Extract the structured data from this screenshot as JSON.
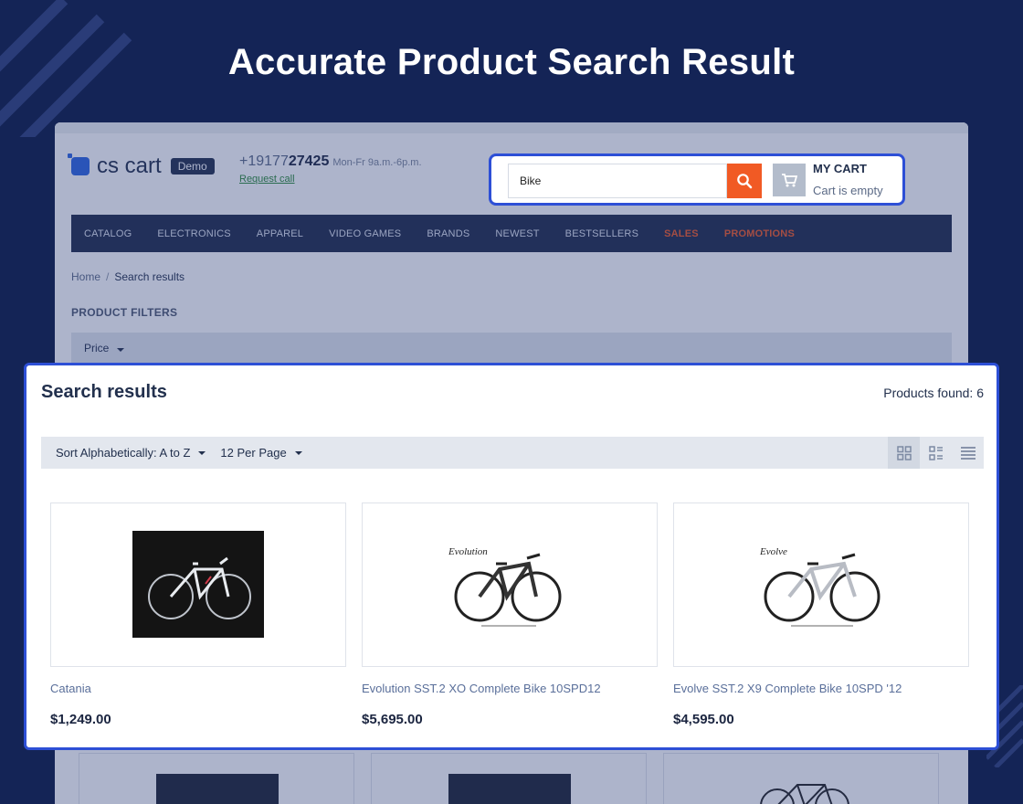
{
  "page": {
    "title": "Accurate Product Search Result"
  },
  "store": {
    "logo_text": "cs cart",
    "logo_badge": "Demo",
    "phone_prefix": "+19177",
    "phone_main": "27425",
    "phone_hours": "Mon-Fr 9a.m.-6p.m.",
    "request_call": "Request call",
    "search_value": "Bike",
    "cart_title": "MY CART",
    "cart_status": "Cart is empty",
    "nav": [
      {
        "label": "CATALOG",
        "highlight": false
      },
      {
        "label": "ELECTRONICS",
        "highlight": false
      },
      {
        "label": "APPAREL",
        "highlight": false
      },
      {
        "label": "VIDEO GAMES",
        "highlight": false
      },
      {
        "label": "BRANDS",
        "highlight": false
      },
      {
        "label": "NEWEST",
        "highlight": false
      },
      {
        "label": "BESTSELLERS",
        "highlight": false
      },
      {
        "label": "SALES",
        "highlight": true
      },
      {
        "label": "PROMOTIONS",
        "highlight": true
      }
    ],
    "breadcrumb": {
      "home": "Home",
      "separator": "/",
      "current": "Search results"
    },
    "filters_title": "PRODUCT FILTERS",
    "price_filter": "Price"
  },
  "results": {
    "title": "Search results",
    "found": "Products found: 6",
    "sort_label": "Sort Alphabetically: A to Z",
    "per_page_label": "12 Per Page",
    "views": [
      "grid-view-icon",
      "list-view-icon",
      "compact-list-icon"
    ],
    "products": [
      {
        "name": "Catania",
        "price": "$1,249.00",
        "image": "road-bike-photo",
        "brand_mark": ""
      },
      {
        "name": "Evolution SST.2 XO Complete Bike 10SPD12",
        "price": "$5,695.00",
        "image": "mountain-bike-dark-photo",
        "brand_mark": "Evolution"
      },
      {
        "name": "Evolve SST.2 X9 Complete Bike 10SPD '12",
        "price": "$4,595.00",
        "image": "mountain-bike-silver-photo",
        "brand_mark": "Evolve"
      }
    ]
  },
  "colors": {
    "background": "#142456",
    "accent": "#2d4fd6",
    "search_button": "#f15a24",
    "navbar": "#1f2b4a"
  }
}
